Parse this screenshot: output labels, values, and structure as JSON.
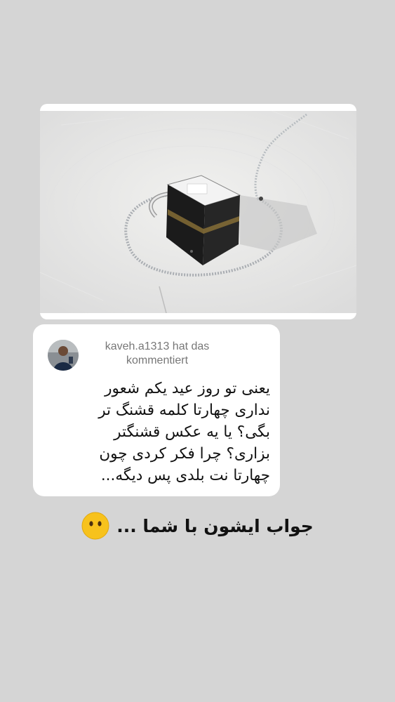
{
  "post": {
    "image_alt": "Kaaba aerial view"
  },
  "comment": {
    "author": "kaveh.a1313 hat das kommentiert",
    "text": "یعنی تو روز عید یکم شعور نداری چهارتا کلمه قشنگ تر بگی؟ یا یه عکس قشنگتر بزاری؟ چرا فکر کردی چون چهارتا نت بلدی پس دیگه..."
  },
  "reply": {
    "text": "جواب ایشون با شما ...",
    "emoji": "no-mouth-face-icon"
  },
  "colors": {
    "background": "#d5d5d5",
    "card": "#ffffff",
    "emoji": "#f7c21c"
  }
}
